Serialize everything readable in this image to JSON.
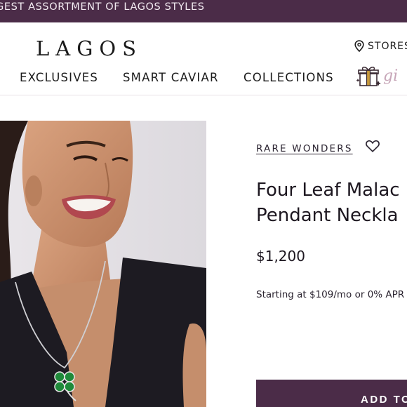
{
  "promo": {
    "text": "GEST ASSORTMENT OF LAGOS STYLES"
  },
  "header": {
    "logo": "LAGOS",
    "stores_label": "STORES",
    "nav": [
      "EXCLUSIVES",
      "SMART CAVIAR",
      "COLLECTIONS"
    ],
    "gifts_label": "gi"
  },
  "product": {
    "collection": "RARE WONDERS",
    "title_line1": "Four Leaf Malac",
    "title_line2": "Pendant Neckla",
    "price": "$1,200",
    "financing": "Starting at $109/mo or 0% APR",
    "add_button": "ADD TO"
  },
  "colors": {
    "brand_plum": "#4b2c48",
    "malachite": "#1f8a3a"
  }
}
